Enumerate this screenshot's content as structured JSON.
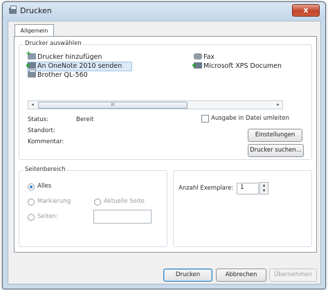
{
  "window": {
    "title": "Drucken",
    "close_glyph": "x"
  },
  "tabs": [
    {
      "label": "Allgemein"
    }
  ],
  "printer_group": {
    "label": "Drucker auswählen",
    "printers": [
      {
        "name": "Drucker hinzufügen",
        "icon": "add-printer-icon"
      },
      {
        "name": "An OneNote 2010 senden",
        "icon": "onenote-printer-icon",
        "selected": true
      },
      {
        "name": "Brother QL-560",
        "icon": "printer-icon"
      },
      {
        "name": "Fax",
        "icon": "fax-icon"
      },
      {
        "name": "Microsoft XPS Documen",
        "icon": "xps-printer-icon"
      }
    ],
    "scroll_left": "◂",
    "scroll_right": "▸",
    "scroll_grip": "III",
    "status_label": "Status:",
    "status_value": "Bereit",
    "location_label": "Standort:",
    "comment_label": "Kommentar:",
    "print_to_file_label": "Ausgabe in Datei umleiten",
    "preferences_button": "Einstellungen",
    "find_printer_button": "Drucker suchen..."
  },
  "page_range": {
    "label": "Seitenbereich",
    "all_label": "Alles",
    "selection_label": "Markierung",
    "current_page_label": "Aktuelle Seite",
    "pages_label": "Seiten:",
    "pages_value": ""
  },
  "copies": {
    "label": "Anzahl Exemplare:",
    "value": "1",
    "up_glyph": "▲",
    "down_glyph": "▼"
  },
  "footer": {
    "print_button": "Drucken",
    "cancel_button": "Abbrechen",
    "apply_button": "Übernehmen"
  },
  "colors": {
    "accent": "#2f7fd2",
    "selection_bg": "#dbe9f8",
    "close_button": "#c0452b"
  }
}
